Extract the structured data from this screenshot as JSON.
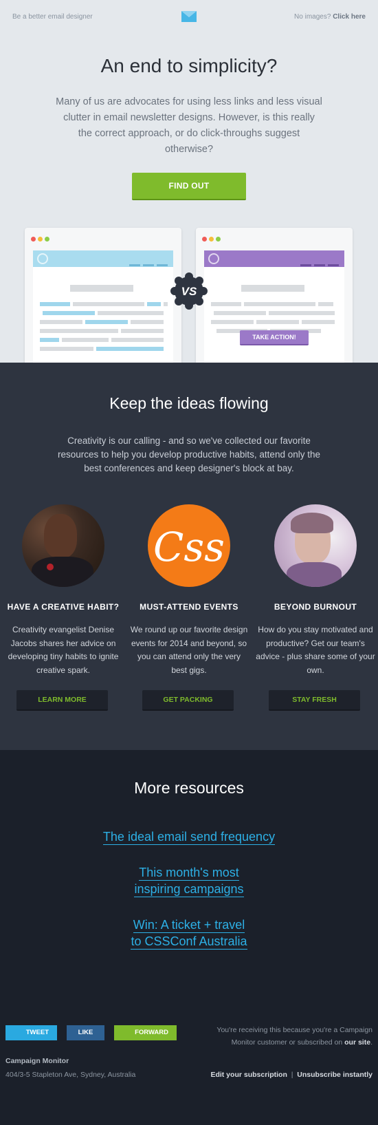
{
  "topbar": {
    "tagline": "Be a better email designer",
    "no_images_prefix": "No images?",
    "no_images_link": "Click here"
  },
  "hero": {
    "title": "An end to simplicity?",
    "lead": "Many of us are advocates for using less links and less visual clutter in email newsletter designs. However, is this really the correct approach, or do click-throughs suggest otherwise?",
    "cta": "FIND OUT",
    "mock_cta": "TAKE ACTION!",
    "vs": "VS"
  },
  "ideas": {
    "title": "Keep the ideas flowing",
    "lead": "Creativity is our calling - and so we've collected our favorite resources to help you develop productive habits, attend only the best conferences and keep designer's block at bay.",
    "columns": [
      {
        "heading": "HAVE A CREATIVE HABIT?",
        "text": "Creativity evangelist Denise Jacobs shares her advice on developing tiny habits to ignite creative spark.",
        "button": "LEARN MORE"
      },
      {
        "heading": "MUST-ATTEND EVENTS",
        "text": "We round up our favorite design events for 2014 and beyond, so you can attend only the very best gigs.",
        "button": "GET PACKING",
        "badge_text": "Css"
      },
      {
        "heading": "BEYOND BURNOUT",
        "text": "How do you stay motivated and productive? Get our team's advice - plus share some of your own.",
        "button": "STAY FRESH"
      }
    ]
  },
  "resources": {
    "title": "More resources",
    "links": [
      [
        "The ideal email send frequency"
      ],
      [
        "This month's most",
        "inspiring campaigns"
      ],
      [
        "Win: A ticket + travel",
        "to CSSConf Australia"
      ]
    ]
  },
  "footer": {
    "tweet": "TWEET",
    "like": "LIKE",
    "forward": "FORWARD",
    "company": "Campaign Monitor",
    "address": "404/3-5 Stapleton Ave, Sydney, Australia",
    "notice_prefix": "You're receiving this because you're a Campaign Monitor customer or subscribed on",
    "notice_link": "our site",
    "notice_suffix": ".",
    "edit_subscription": "Edit your subscription",
    "separator": "|",
    "unsubscribe": "Unsubscribe instantly"
  },
  "colors": {
    "accent_green": "#7fbb2c",
    "link_blue": "#2db0e6",
    "dark_panel": "#2e3440",
    "darker_panel": "#1b202a",
    "hero_bg": "#e4e8ec",
    "purple": "#9b79c8"
  }
}
